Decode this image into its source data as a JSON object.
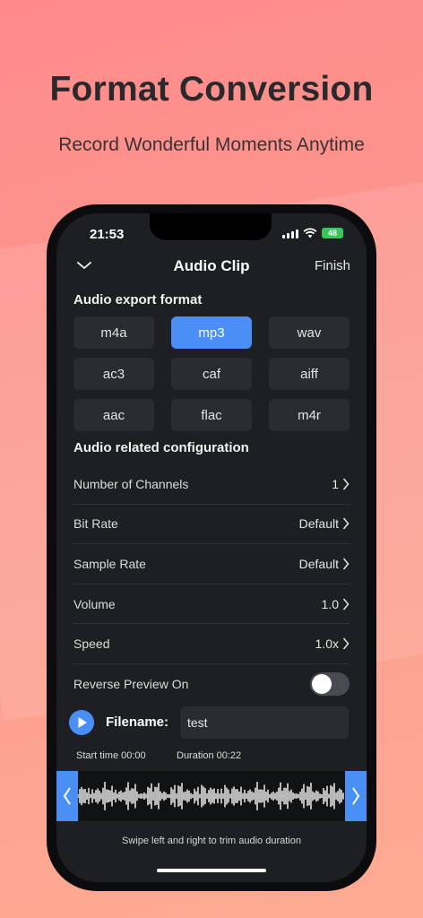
{
  "promo": {
    "title": "Format Conversion",
    "subtitle": "Record Wonderful Moments Anytime"
  },
  "status_bar": {
    "time": "21:53",
    "battery": "48"
  },
  "nav": {
    "title": "Audio Clip",
    "finish_label": "Finish",
    "back_icon": "chevron-down-icon"
  },
  "export": {
    "section_title": "Audio export format",
    "formats": [
      "m4a",
      "mp3",
      "wav",
      "ac3",
      "caf",
      "aiff",
      "aac",
      "flac",
      "m4r"
    ],
    "selected": "mp3"
  },
  "config": {
    "section_title": "Audio related configuration",
    "channels": {
      "label": "Number of Channels",
      "value": "1"
    },
    "bit_rate": {
      "label": "Bit Rate",
      "value": "Default"
    },
    "sample_rate": {
      "label": "Sample Rate",
      "value": "Default"
    },
    "volume": {
      "label": "Volume",
      "value": "1.0"
    },
    "speed": {
      "label": "Speed",
      "value": "1.0x"
    },
    "reverse": {
      "label": "Reverse Preview On",
      "on": false
    }
  },
  "filename": {
    "label": "Filename:",
    "value": "test"
  },
  "trim": {
    "start_time": "Start time 00:00",
    "duration": "Duration 00:22",
    "hint": "Swipe left and right to trim audio duration"
  },
  "colors": {
    "accent": "#4a8ff6",
    "screen_bg": "#1e1f23",
    "button_bg": "#2b2c31"
  }
}
